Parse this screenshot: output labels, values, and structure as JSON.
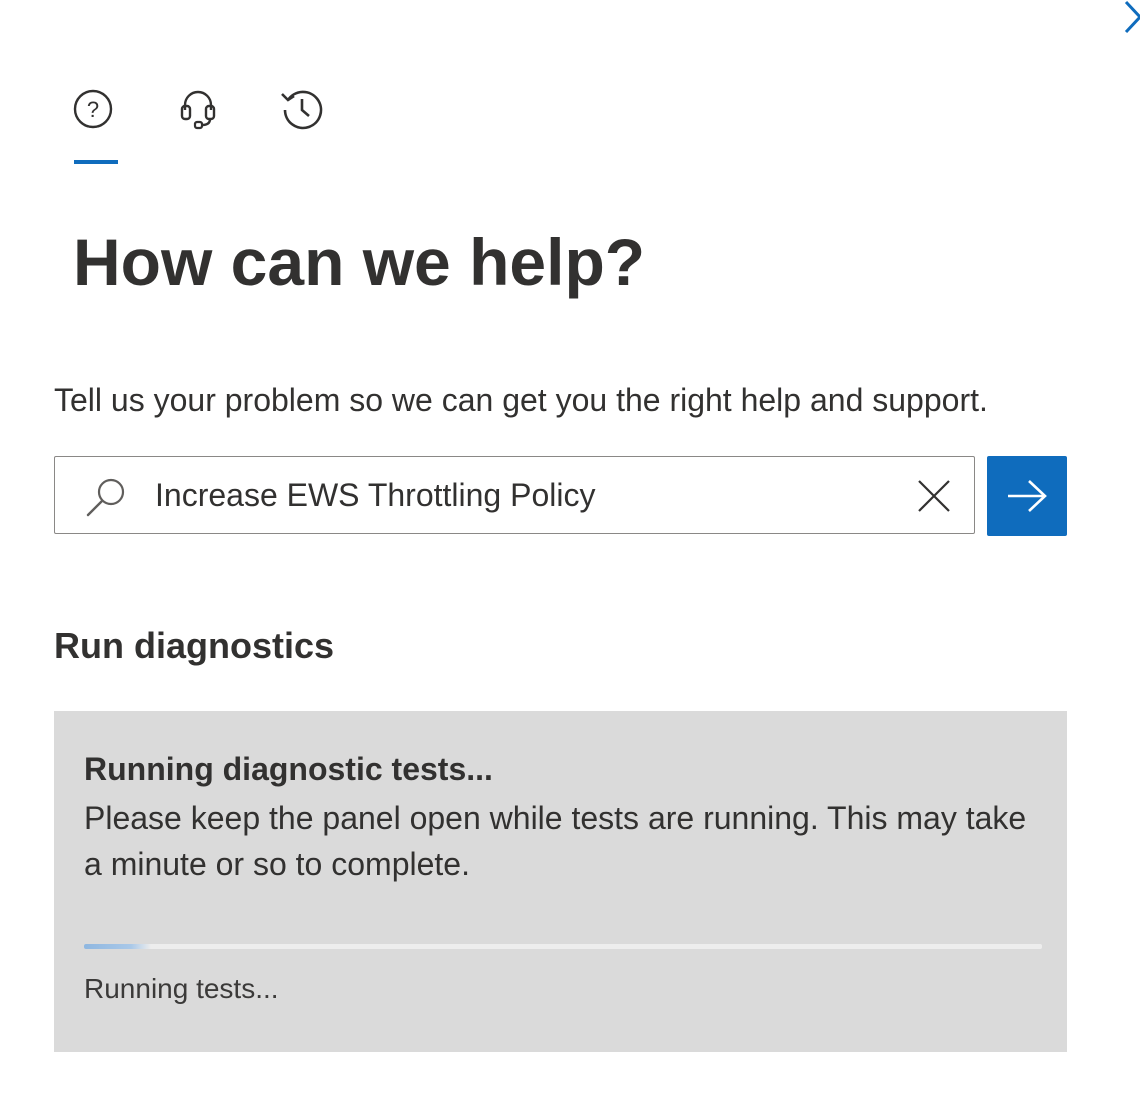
{
  "icons": {
    "close": "chevron-right-icon",
    "help_tab": "question-circle-icon",
    "contact_tab": "headset-icon",
    "history_tab": "history-icon",
    "search": "search-icon",
    "clear": "close-icon",
    "submit": "arrow-right-icon"
  },
  "tabs": {
    "active": "help"
  },
  "header": {
    "title": "How can we help?",
    "subtitle": "Tell us your problem so we can get you the right help and support."
  },
  "search": {
    "value": "Increase EWS Throttling Policy",
    "placeholder": ""
  },
  "diagnostics": {
    "section_title": "Run diagnostics",
    "card_heading": "Running diagnostic tests...",
    "card_body": "Please keep the panel open while tests are running. This may take a minute or so to complete.",
    "progress_fraction": 0.07,
    "progress_label": "Running tests..."
  },
  "colors": {
    "accent": "#0f6cbd",
    "card_background": "#dadada",
    "text": "#323130"
  }
}
